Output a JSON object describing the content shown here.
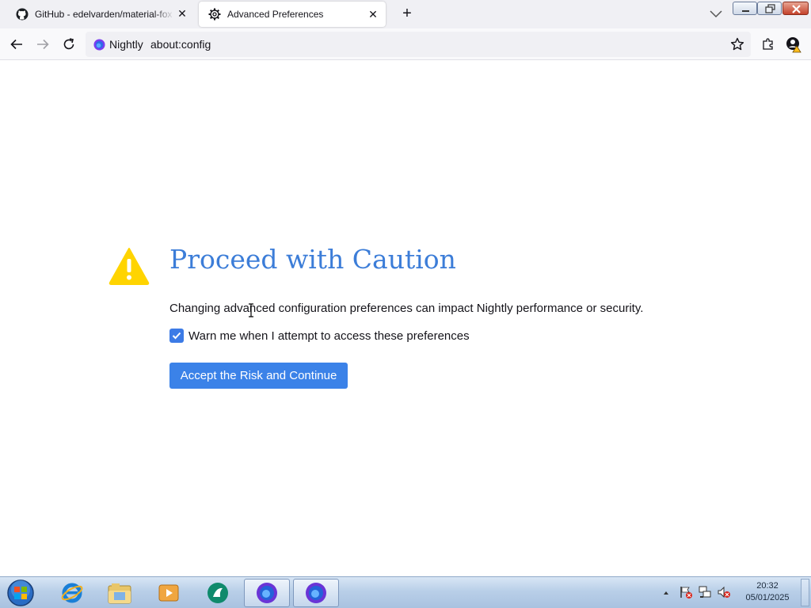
{
  "browser": {
    "tabs": [
      {
        "title": "GitHub - edelvarden/material-fox",
        "icon": "github-icon",
        "active": false
      },
      {
        "title": "Advanced Preferences",
        "icon": "gear-icon",
        "active": true
      }
    ],
    "identity_label": "Nightly",
    "url": "about:config"
  },
  "page": {
    "title": "Proceed with Caution",
    "description": "Changing advanced configuration preferences can impact Nightly performance or security.",
    "checkbox_label": "Warn me when I attempt to access these preferences",
    "checkbox_checked": true,
    "accept_button": "Accept the Risk and Continue"
  },
  "taskbar": {
    "items": [
      "start-orb",
      "internet-explorer-icon",
      "windows-explorer-icon",
      "media-player-icon",
      "app-icon",
      "firefox-nightly-icon",
      "firefox-nightly-icon"
    ],
    "clock_time": "20:32",
    "clock_date": "05/01/2025"
  },
  "colors": {
    "accent": "#3b82e8",
    "title": "#3c7dd8",
    "warning": "#ffd400"
  }
}
